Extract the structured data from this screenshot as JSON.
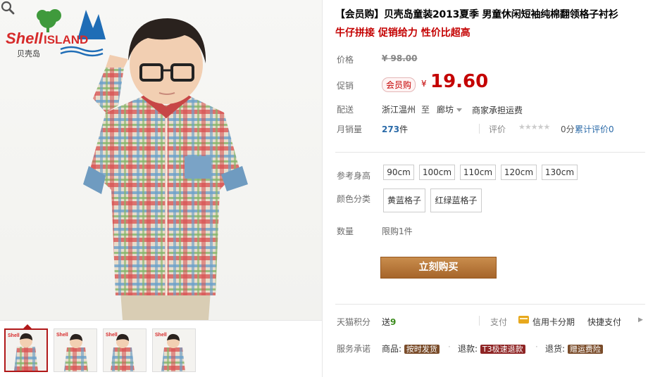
{
  "brand": {
    "name": "ShellISLAND",
    "name_cn": "贝壳岛"
  },
  "product": {
    "title": "【会员购】贝壳岛童装2013夏季 男童休闲短袖纯棉翻领格子衬衫",
    "subtitle": "牛仔拼接 促销给力 性价比超高"
  },
  "price": {
    "label": "价格",
    "original": "¥ 98.00"
  },
  "promo": {
    "label": "促销",
    "badge": "会员购",
    "currency": "¥",
    "value": "19.60"
  },
  "shipping": {
    "label": "配送",
    "from": "浙江温州",
    "to_word": "至",
    "to": "廊坊",
    "fee": "商家承担运费"
  },
  "sales": {
    "label": "月销量",
    "count": "273",
    "unit": "件",
    "rating_label": "评价",
    "stars": "★★★★★",
    "score": "0分",
    "review_link": "累计评价0"
  },
  "options": {
    "height_label": "参考身高",
    "heights": [
      "90cm",
      "100cm",
      "110cm",
      "120cm",
      "130cm"
    ],
    "color_label": "颜色分类",
    "colors": [
      "黄蓝格子",
      "红绿蓝格子"
    ],
    "qty_label": "数量",
    "qty_limit": "限购1件"
  },
  "buy_button": "立刻购买",
  "points": {
    "label": "天猫积分",
    "prefix": "送",
    "value": "9",
    "pay_label": "支付",
    "credit": "信用卡分期",
    "quick": "快捷支付"
  },
  "service": {
    "label": "服务承诺",
    "goods_label": "商品:",
    "goods_tag": "按时发货",
    "refund_label": "退款:",
    "refund_tag": "T3极速退款",
    "return_label": "退货:",
    "return_tag": "赠运费险"
  },
  "colors": {
    "accent_red": "#c40000",
    "buy_button": "#b47434",
    "points_green": "#3b8b1c"
  }
}
